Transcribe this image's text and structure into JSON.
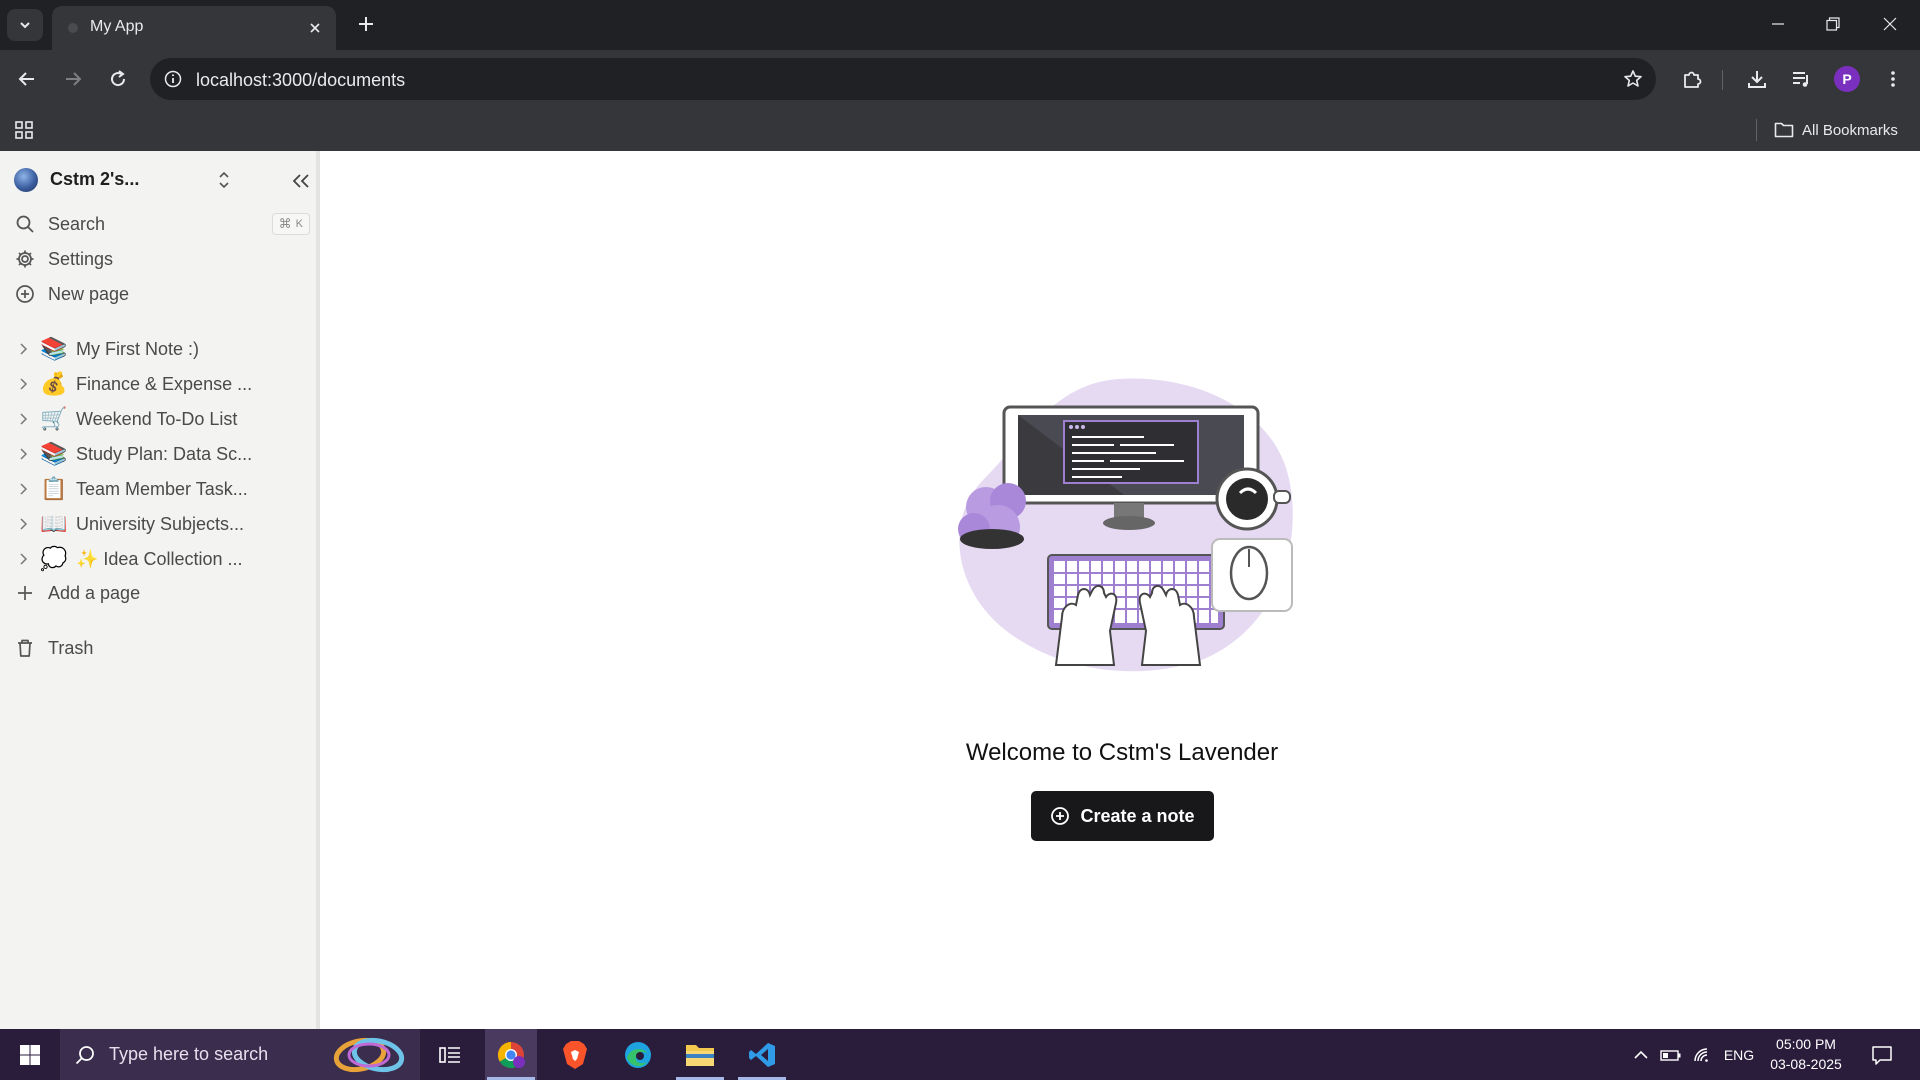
{
  "browser": {
    "tab_title": "My App",
    "url": "localhost:3000/documents",
    "profile_initial": "P",
    "all_bookmarks_label": "All Bookmarks"
  },
  "sidebar": {
    "workspace_name": "Cstm 2's...",
    "search_label": "Search",
    "search_shortcut_symbol": "⌘",
    "search_shortcut_key": "K",
    "settings_label": "Settings",
    "new_page_label": "New page",
    "pages": [
      {
        "emoji": "📚",
        "label": "My First Note :)"
      },
      {
        "emoji": "💰",
        "label": "Finance & Expense ..."
      },
      {
        "emoji": "🛒",
        "label": "Weekend To-Do List"
      },
      {
        "emoji": "📚",
        "label": "Study Plan: Data Sc..."
      },
      {
        "emoji": "📋",
        "label": "Team Member Task..."
      },
      {
        "emoji": "📖",
        "label": "University Subjects..."
      },
      {
        "emoji": "💭",
        "label": "✨ Idea Collection ..."
      }
    ],
    "add_page_label": "Add a page",
    "trash_label": "Trash"
  },
  "main": {
    "welcome_text": "Welcome to Cstm's Lavender",
    "create_button_label": "Create a note"
  },
  "taskbar": {
    "search_placeholder": "Type here to search",
    "language": "ENG",
    "time": "05:00 PM",
    "date": "03-08-2025"
  },
  "colors": {
    "accent": "#18181b",
    "illustration_lavender": "#e6daf3",
    "illustration_purple": "#9e7fd0",
    "taskbar": "#2a1d3c"
  }
}
